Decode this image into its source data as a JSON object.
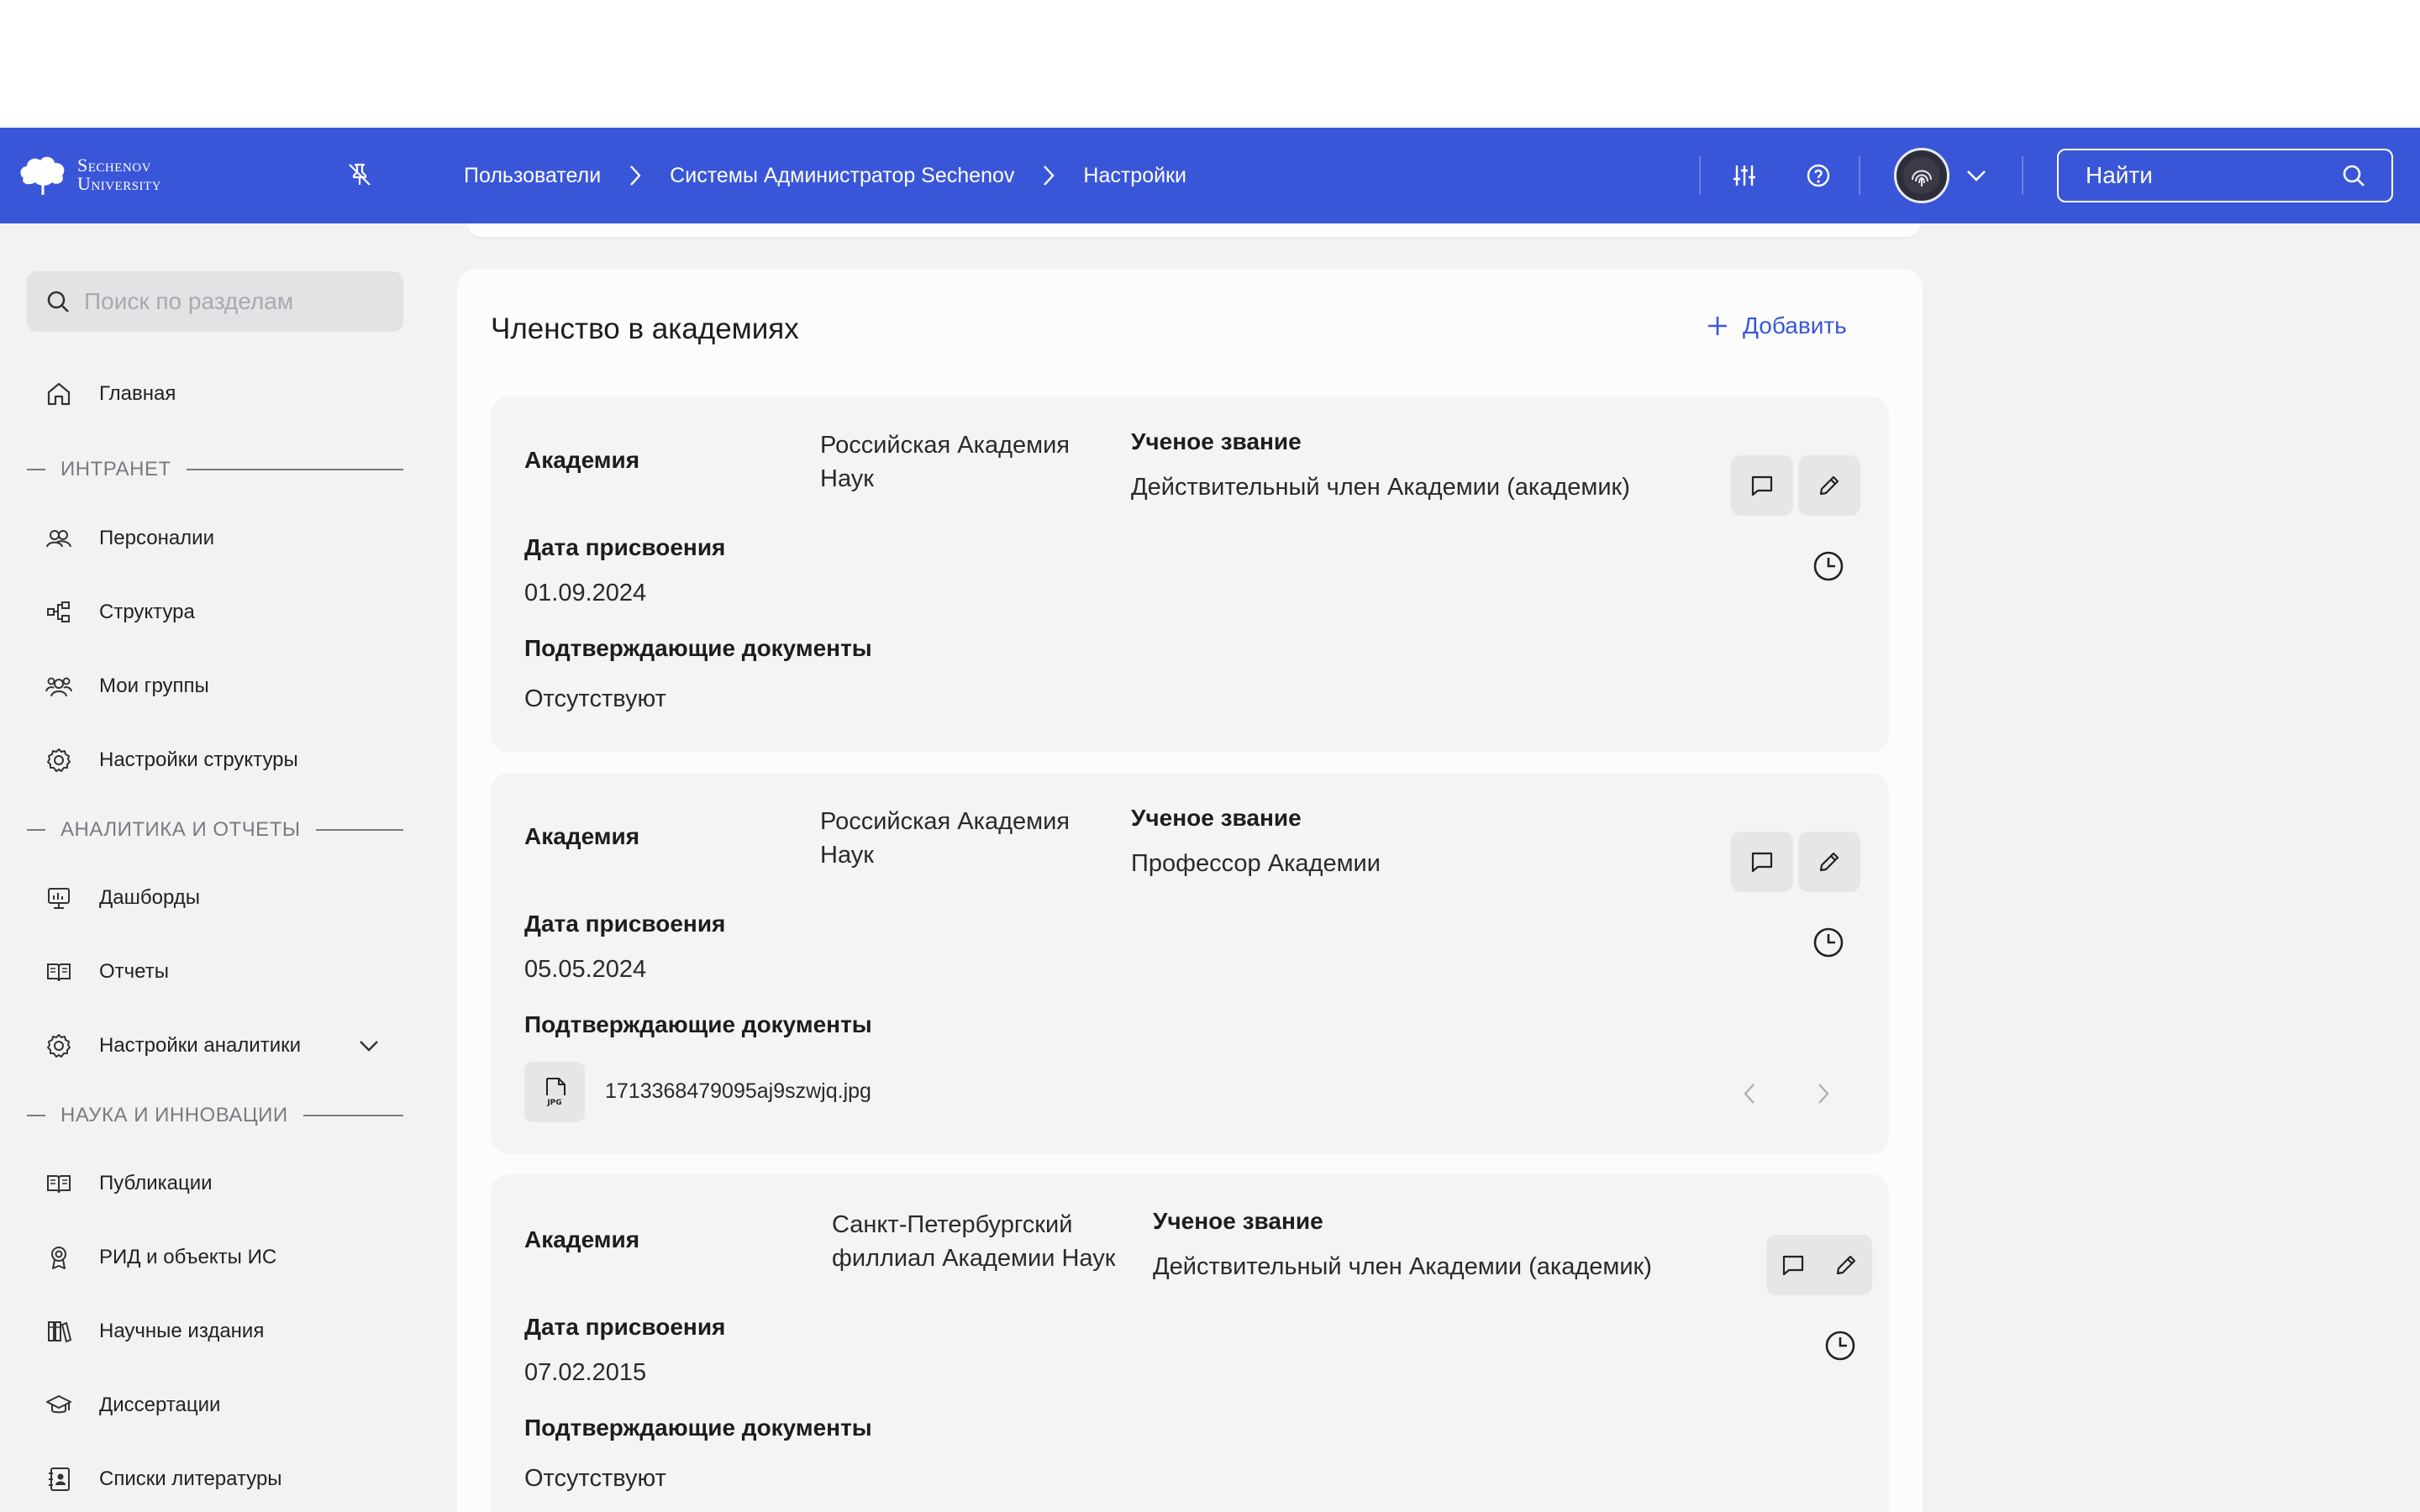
{
  "header": {
    "logo_line1": "Sechenov",
    "logo_line2": "University",
    "breadcrumbs": [
      "Пользователи",
      "Системы Администратор Sechenov",
      "Настройки"
    ],
    "search_placeholder": "Найти"
  },
  "sidebar": {
    "search_placeholder": "Поиск по разделам",
    "home": "Главная",
    "sections": [
      {
        "title": "ИНТРАНЕТ",
        "items": [
          "Персоналии",
          "Структура",
          "Мои группы",
          "Настройки структуры"
        ]
      },
      {
        "title": "АНАЛИТИКА И ОТЧЕТЫ",
        "items": [
          "Дашборды",
          "Отчеты",
          "Настройки аналитики"
        ]
      },
      {
        "title": "НАУКА И ИННОВАЦИИ",
        "items": [
          "Публикации",
          "РИД и объекты ИС",
          "Научные издания",
          "Диссертации",
          "Списки литературы"
        ]
      }
    ]
  },
  "main": {
    "title": "Членство в академиях",
    "add_label": "Добавить",
    "labels": {
      "academy": "Академия",
      "rank": "Ученое звание",
      "date": "Дата присвоения",
      "docs": "Подтверждающие документы"
    },
    "entries": [
      {
        "academy_line1": "Российская Академия",
        "academy_line2": "Наук",
        "rank": "Действительный член Академии (академик)",
        "date": "01.09.2024",
        "docs": "Отсутствуют"
      },
      {
        "academy_line1": "Российская Академия",
        "academy_line2": "Наук",
        "rank": "Профессор Академии",
        "date": "05.05.2024",
        "file_type": "JPG",
        "file_name": "1713368479095aj9szwjq.jpg"
      },
      {
        "academy_line1": "Санкт-Петербургский",
        "academy_line2": "филлиал Академии Наук",
        "rank": "Действительный член Академии (академик)",
        "date": "07.02.2015",
        "docs": "Отсутствуют"
      }
    ]
  },
  "colors": {
    "brand": "#3a56d8",
    "page_bg": "#f2f2f3",
    "card_bg": "#fcfcfd",
    "entry_bg": "#f4f4f5"
  }
}
